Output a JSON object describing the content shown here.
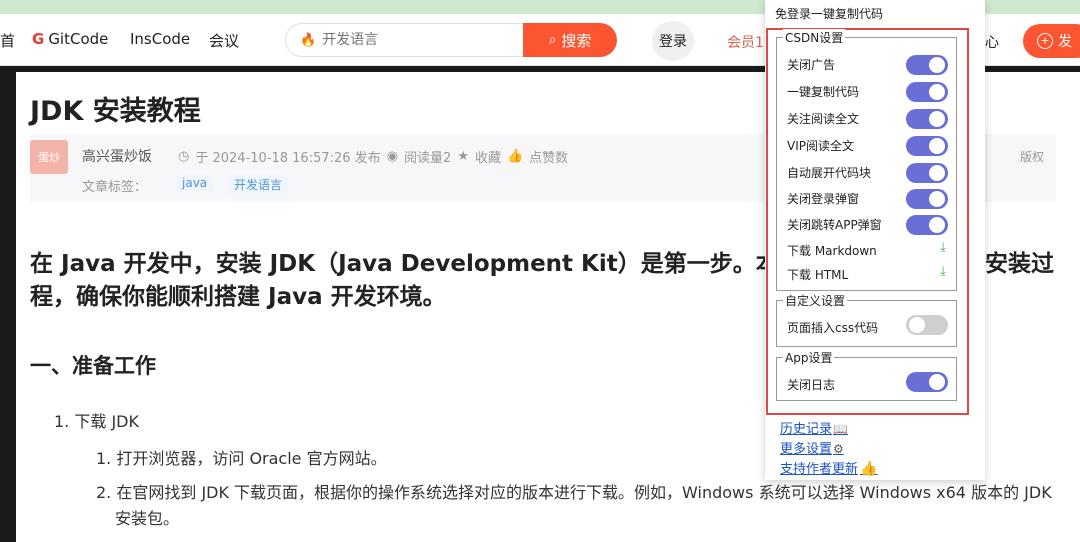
{
  "nav": {
    "partial_item": "首",
    "gitcode_logo": "G",
    "gitcode": "GitCode",
    "inscode": "InsCode",
    "meeting": "会议",
    "search_placeholder": "开发语言",
    "search_button": "搜索",
    "login": "登录",
    "vip": "会员1",
    "partial_right": "心",
    "publish": "发"
  },
  "article": {
    "title": "JDK 安装教程",
    "author": "高兴蛋炒饭",
    "avatar_text": "蛋炒",
    "published": "于 2024-10-18 16:57:26 发布",
    "reads": "阅读量2",
    "favorite": "收藏",
    "like": "点赞数",
    "copyright": "版权",
    "tags_label": "文章标签：",
    "tags": [
      "java",
      "开发语言"
    ],
    "intro_line1": "在 Java 开发中，安装 JDK（Java Development Kit）是第一步。本文",
    "intro_line1_tail": "安装过",
    "intro_line2": "程，确保你能顺利搭建 Java 开发环境。",
    "section_heading": "一、准备工作",
    "item1": "1. 下载 JDK",
    "item1_1": "1. 打开浏览器，访问 Oracle 官方网站。",
    "item1_2": "2. 在官网找到 JDK 下载页面，根据你的操作系统选择对应的版本进行下载。例如，Windows 系统可以选择 Windows x64 版本的 JDK 安装包。"
  },
  "popup": {
    "header": "免登录一键复制代码",
    "csdn_legend": "CSDN设置",
    "csdn_items": [
      {
        "label": "关闭广告",
        "on": true
      },
      {
        "label": "一键复制代码",
        "on": true
      },
      {
        "label": "关注阅读全文",
        "on": true
      },
      {
        "label": "VIP阅读全文",
        "on": true
      },
      {
        "label": "自动展开代码块",
        "on": true
      },
      {
        "label": "关闭登录弹窗",
        "on": true
      },
      {
        "label": "关闭跳转APP弹窗",
        "on": true
      }
    ],
    "download_md": "下载 Markdown",
    "download_html": "下载 HTML",
    "custom_legend": "自定义设置",
    "custom_item": "页面插入css代码",
    "app_legend": "App设置",
    "app_item": "关闭日志",
    "link_history": "历史记录",
    "link_more": "更多设置",
    "link_support": "支持作者更新"
  },
  "colors": {
    "accent": "#fc5531",
    "toggle_on": "#6a6fd8",
    "toggle_off": "#cfcfcf",
    "highlight_border": "#e04848"
  }
}
